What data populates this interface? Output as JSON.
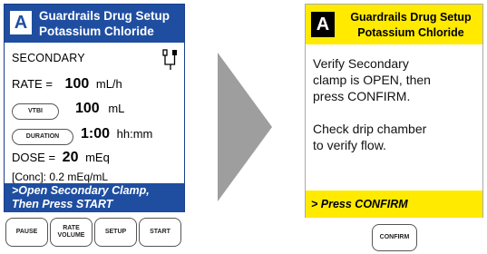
{
  "left": {
    "badge": "A",
    "title_line1": "Guardrails Drug Setup",
    "title_line2": "Potassium Chloride",
    "secondary_label": "SECONDARY",
    "rate_label": "RATE =",
    "rate_value": "100",
    "rate_unit": "mL/h",
    "vtbi_button": "VTBI",
    "vtbi_value": "100",
    "vtbi_unit": "mL",
    "duration_button": "DURATION",
    "duration_value": "1:00",
    "duration_unit": "hh:mm",
    "dose_label": "DOSE =",
    "dose_value": "20",
    "dose_unit": "mEq",
    "conc_text": "[Conc]: 0.2 mEq/mL",
    "status_line1": ">Open Secondary Clamp,",
    "status_line2": "Then Press START",
    "softkeys": {
      "pause": "PAUSE",
      "rate_volume_line1": "RATE",
      "rate_volume_line2": "VOLUME",
      "setup": "SETUP",
      "start": "START"
    }
  },
  "right": {
    "badge": "A",
    "title_line1": "Guardrails Drug Setup",
    "title_line2": "Potassium Chloride",
    "msg_para1_line1": "Verify Secondary",
    "msg_para1_line2": "clamp is OPEN, then",
    "msg_para1_line3": "press CONFIRM.",
    "msg_para2_line1": "Check drip chamber",
    "msg_para2_line2": "to verify flow.",
    "status": "> Press CONFIRM",
    "confirm_button": "CONFIRM"
  },
  "colors": {
    "blue_header": "#1f4ea1",
    "yellow_header": "#ffea00",
    "arrow_gray": "#9e9e9e"
  },
  "icons": {
    "secondary_set": "iv-line-icon",
    "transition": "right-arrow-icon"
  }
}
